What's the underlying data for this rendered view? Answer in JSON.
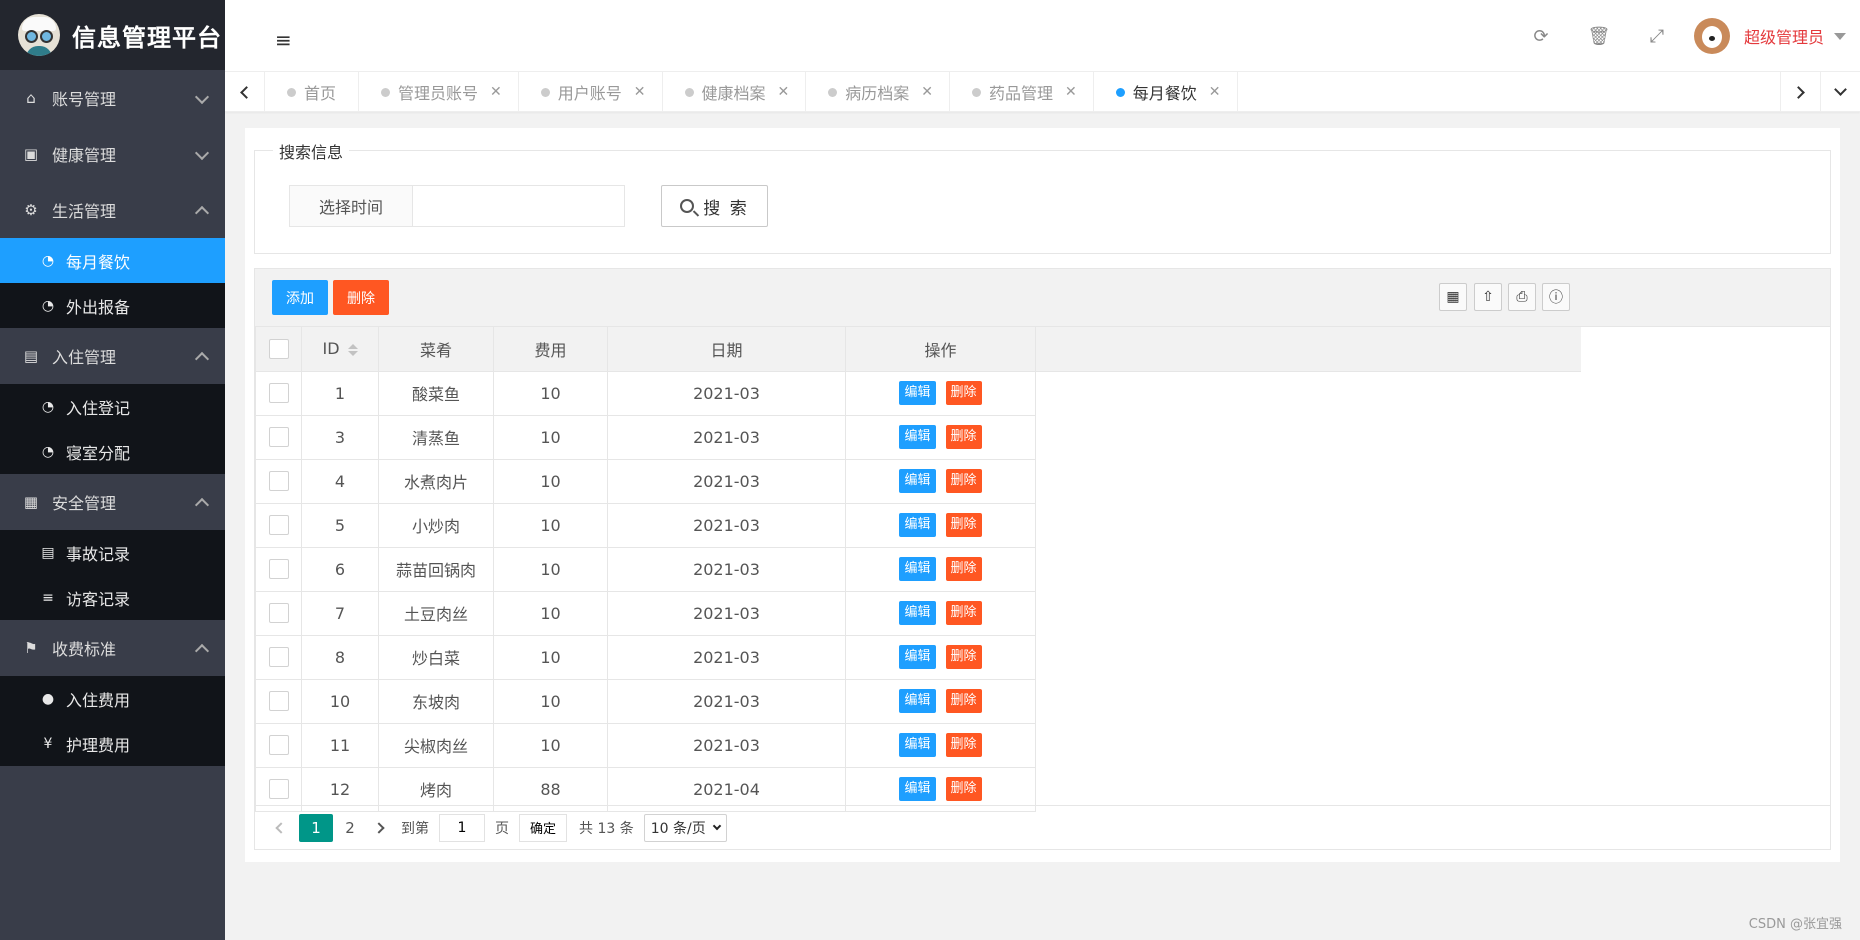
{
  "app": {
    "title": "信息管理平台"
  },
  "sidebar": {
    "groups": [
      {
        "label": "账号管理",
        "icon": "home-icon",
        "expanded": false,
        "items": []
      },
      {
        "label": "健康管理",
        "icon": "window-icon",
        "expanded": false,
        "items": []
      },
      {
        "label": "生活管理",
        "icon": "gears-icon",
        "expanded": true,
        "items": [
          {
            "label": "每月餐饮",
            "active": true
          },
          {
            "label": "外出报备"
          }
        ]
      },
      {
        "label": "入住管理",
        "icon": "file-icon",
        "expanded": true,
        "items": [
          {
            "label": "入住登记"
          },
          {
            "label": "寝室分配"
          }
        ]
      },
      {
        "label": "安全管理",
        "icon": "calendar-icon",
        "expanded": true,
        "items": [
          {
            "label": "事故记录"
          },
          {
            "label": "访客记录"
          }
        ]
      },
      {
        "label": "收费标准",
        "icon": "flag-icon",
        "expanded": true,
        "items": [
          {
            "label": "入住费用"
          },
          {
            "label": "护理费用"
          }
        ]
      }
    ]
  },
  "header": {
    "username": "超级管理员"
  },
  "tabs": [
    {
      "label": "首页",
      "closable": false
    },
    {
      "label": "管理员账号",
      "closable": true
    },
    {
      "label": "用户账号",
      "closable": true
    },
    {
      "label": "健康档案",
      "closable": true
    },
    {
      "label": "病历档案",
      "closable": true
    },
    {
      "label": "药品管理",
      "closable": true
    },
    {
      "label": "每月餐饮",
      "closable": true,
      "active": true
    }
  ],
  "search": {
    "legend": "搜索信息",
    "time_label": "选择时间",
    "time_value": "",
    "button": "搜 索"
  },
  "toolbar": {
    "add": "添加",
    "delete": "删除"
  },
  "table": {
    "columns": [
      "ID",
      "菜肴",
      "费用",
      "日期",
      "操作"
    ],
    "edit_label": "编辑",
    "delete_label": "删除",
    "rows": [
      {
        "id": "1",
        "dish": "酸菜鱼",
        "cost": "10",
        "date": "2021-03"
      },
      {
        "id": "3",
        "dish": "清蒸鱼",
        "cost": "10",
        "date": "2021-03"
      },
      {
        "id": "4",
        "dish": "水煮肉片",
        "cost": "10",
        "date": "2021-03"
      },
      {
        "id": "5",
        "dish": "小炒肉",
        "cost": "10",
        "date": "2021-03"
      },
      {
        "id": "6",
        "dish": "蒜苗回锅肉",
        "cost": "10",
        "date": "2021-03"
      },
      {
        "id": "7",
        "dish": "土豆肉丝",
        "cost": "10",
        "date": "2021-03"
      },
      {
        "id": "8",
        "dish": "炒白菜",
        "cost": "10",
        "date": "2021-03"
      },
      {
        "id": "10",
        "dish": "东坡肉",
        "cost": "10",
        "date": "2021-03"
      },
      {
        "id": "11",
        "dish": "尖椒肉丝",
        "cost": "10",
        "date": "2021-03"
      },
      {
        "id": "12",
        "dish": "烤肉",
        "cost": "88",
        "date": "2021-04"
      }
    ]
  },
  "pager": {
    "pages": [
      "1",
      "2"
    ],
    "current": "1",
    "goto_prefix": "到第",
    "goto_value": "1",
    "goto_suffix": "页",
    "confirm": "确定",
    "total": "共 13 条",
    "page_size": "10 条/页"
  },
  "watermark": "CSDN @张宜强"
}
